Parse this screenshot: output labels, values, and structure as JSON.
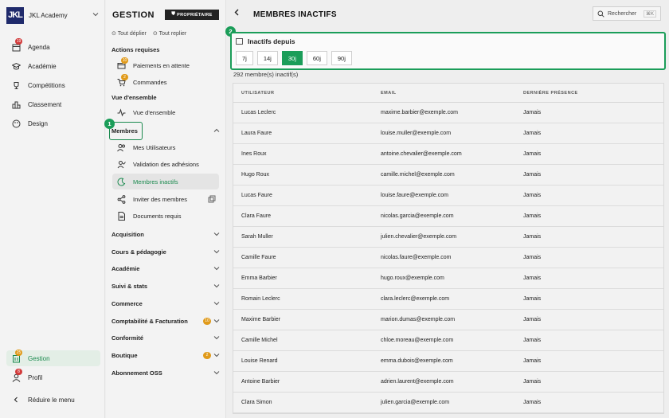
{
  "brand": {
    "logo": "JKL",
    "name": "JKL Academy"
  },
  "leftnav": {
    "items": [
      {
        "label": "Agenda",
        "icon": "calendar-icon",
        "badge": "19"
      },
      {
        "label": "Académie",
        "icon": "graduation-cap-icon",
        "badge": ""
      },
      {
        "label": "Compétitions",
        "icon": "trophy-icon",
        "badge": ""
      },
      {
        "label": "Classement",
        "icon": "podium-icon",
        "badge": ""
      },
      {
        "label": "Design",
        "icon": "palette-icon",
        "badge": ""
      }
    ],
    "gestion": {
      "label": "Gestion",
      "badge": "25"
    },
    "profil": {
      "label": "Profil",
      "badge": "8"
    },
    "collapse": "Réduire le menu"
  },
  "midnav": {
    "title": "GESTION",
    "owner_badge": "PROPRIÉTAIRE",
    "expand_all": "Tout déplier",
    "collapse_all": "Tout replier",
    "actions_heading": "Actions requises",
    "actions": [
      {
        "label": "Paiements en attente",
        "badge": "10"
      },
      {
        "label": "Commandes",
        "badge": "2"
      }
    ],
    "overview_heading": "Vue d'ensemble",
    "overview_item": "Vue d'ensemble",
    "membres_label": "Membres",
    "membres_items": [
      "Mes Utilisateurs",
      "Validation des adhésions",
      "Membres inactifs",
      "Inviter des membres",
      "Documents requis"
    ],
    "groups": [
      {
        "label": "Acquisition",
        "badge": ""
      },
      {
        "label": "Cours & pédagogie",
        "badge": ""
      },
      {
        "label": "Académie",
        "badge": ""
      },
      {
        "label": "Suivi & stats",
        "badge": ""
      },
      {
        "label": "Commerce",
        "badge": ""
      },
      {
        "label": "Comptabilité & Facturation",
        "badge": "10"
      },
      {
        "label": "Conformité",
        "badge": ""
      },
      {
        "label": "Boutique",
        "badge": "2"
      },
      {
        "label": "Abonnement OSS",
        "badge": ""
      }
    ],
    "step1": "1"
  },
  "main": {
    "title": "MEMBRES INACTIFS",
    "search_label": "Rechercher",
    "search_shortcut": "⌘K",
    "filter": {
      "step": "2",
      "title": "Inactifs depuis",
      "options": [
        "7j",
        "14j",
        "30j",
        "60j",
        "90j"
      ],
      "selected": "30j"
    },
    "count_text": "292 membre(s) inactif(s)",
    "table": {
      "headers": [
        "UTILISATEUR",
        "EMAIL",
        "DERNIÈRE PRÉSENCE"
      ],
      "rows": [
        [
          "Lucas Leclerc",
          "maxime.barbier@exemple.com",
          "Jamais"
        ],
        [
          "Laura Faure",
          "louise.muller@exemple.com",
          "Jamais"
        ],
        [
          "Ines Roux",
          "antoine.chevalier@exemple.com",
          "Jamais"
        ],
        [
          "Hugo Roux",
          "camille.michel@exemple.com",
          "Jamais"
        ],
        [
          "Lucas Faure",
          "louise.faure@exemple.com",
          "Jamais"
        ],
        [
          "Clara Faure",
          "nicolas.garcia@exemple.com",
          "Jamais"
        ],
        [
          "Sarah Muller",
          "julien.chevalier@exemple.com",
          "Jamais"
        ],
        [
          "Camille Faure",
          "nicolas.faure@exemple.com",
          "Jamais"
        ],
        [
          "Emma Barbier",
          "hugo.roux@exemple.com",
          "Jamais"
        ],
        [
          "Romain Leclerc",
          "clara.leclerc@exemple.com",
          "Jamais"
        ],
        [
          "Maxime Barbier",
          "marion.dumas@exemple.com",
          "Jamais"
        ],
        [
          "Camille Michel",
          "chloe.moreau@exemple.com",
          "Jamais"
        ],
        [
          "Louise Renard",
          "emma.dubois@exemple.com",
          "Jamais"
        ],
        [
          "Antoine Barbier",
          "adrien.laurent@exemple.com",
          "Jamais"
        ],
        [
          "Clara Simon",
          "julien.garcia@exemple.com",
          "Jamais"
        ]
      ]
    }
  },
  "colors": {
    "accent": "#1b9d59",
    "brand": "#1f2a6b",
    "badge_red": "#d23b3b",
    "badge_orange": "#e09a1a"
  }
}
